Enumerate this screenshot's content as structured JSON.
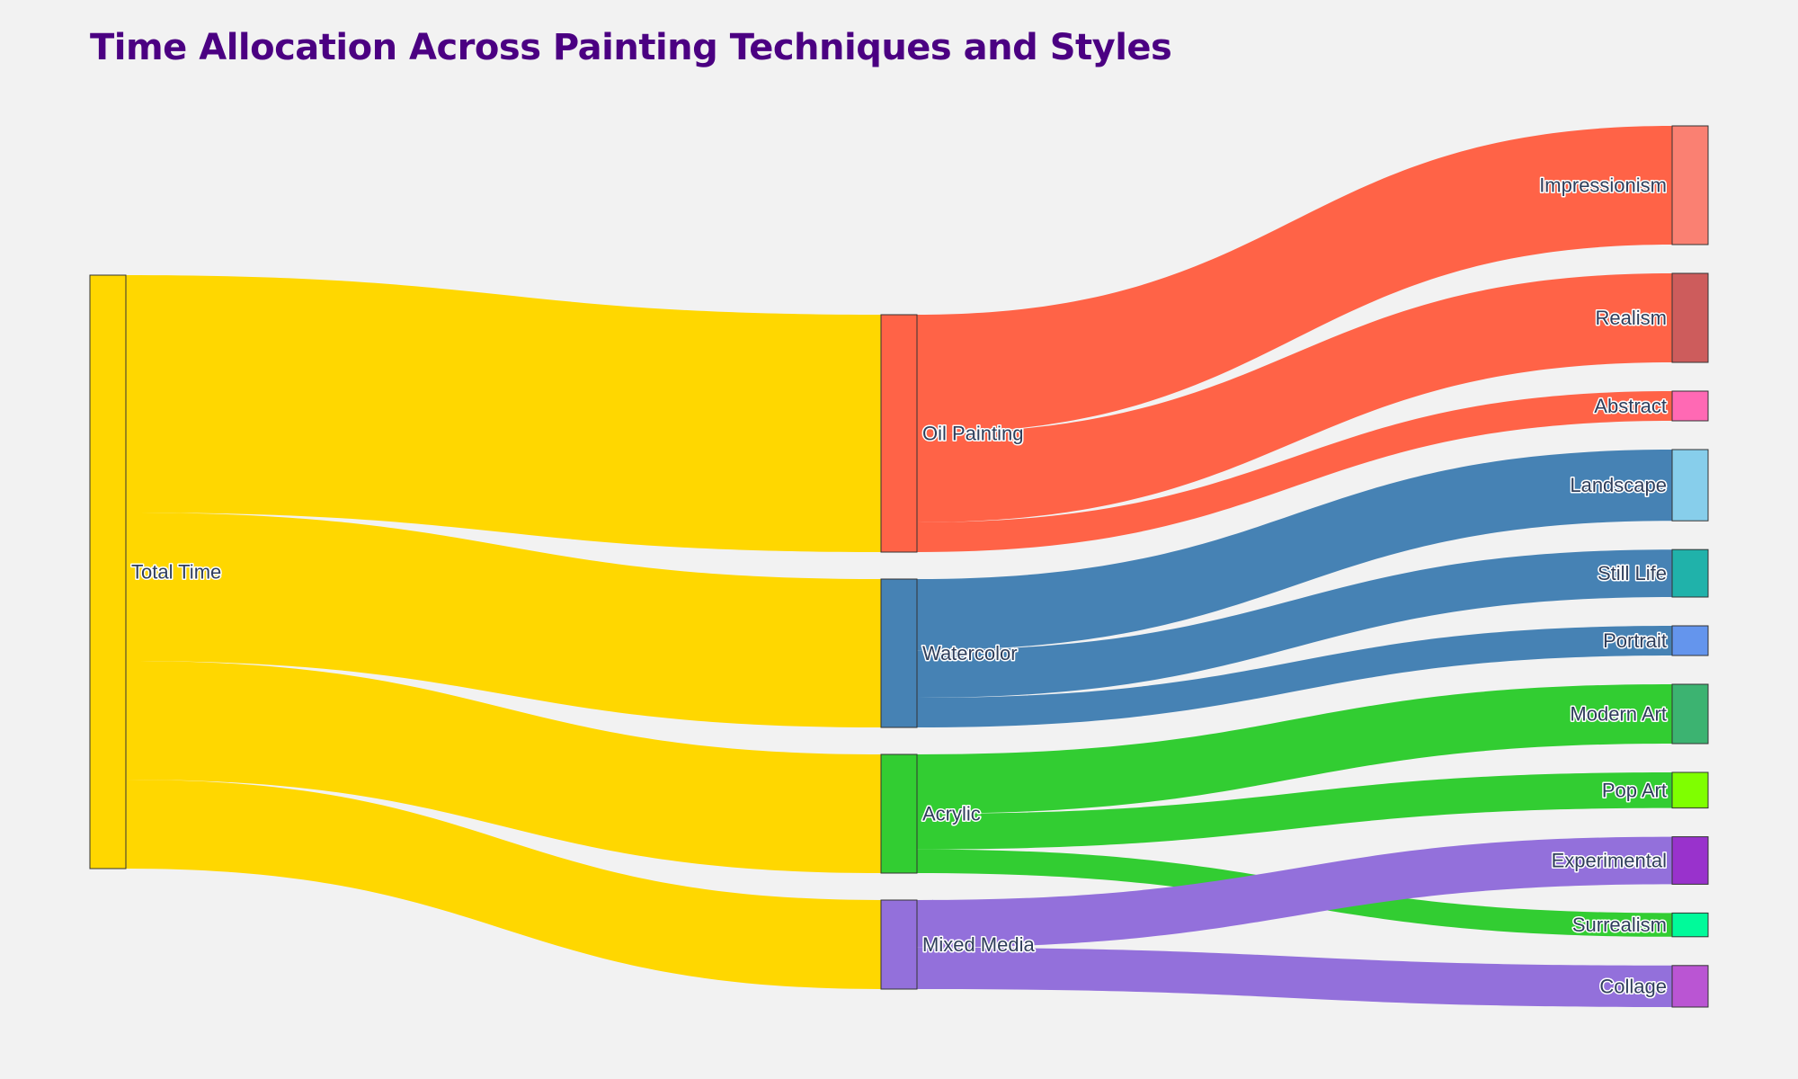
{
  "title": "Time Allocation Across Painting Techniques and Styles",
  "chart_data": {
    "type": "sankey",
    "title": "Time Allocation Across Painting Techniques and Styles",
    "nodes": [
      {
        "id": "Total Time",
        "label": "Total Time",
        "color": "#FFD700",
        "column": 0
      },
      {
        "id": "Oil Painting",
        "label": "Oil Painting",
        "color": "#FF6347",
        "column": 1
      },
      {
        "id": "Watercolor",
        "label": "Watercolor",
        "color": "#4682B4",
        "column": 1
      },
      {
        "id": "Acrylic",
        "label": "Acrylic",
        "color": "#32CD32",
        "column": 1
      },
      {
        "id": "Mixed Media",
        "label": "Mixed Media",
        "color": "#9370DB",
        "column": 1
      },
      {
        "id": "Impressionism",
        "label": "Impressionism",
        "color": "#FA8072",
        "column": 2
      },
      {
        "id": "Realism",
        "label": "Realism",
        "color": "#CD5C5C",
        "column": 2
      },
      {
        "id": "Abstract",
        "label": "Abstract",
        "color": "#FF69B4",
        "column": 2
      },
      {
        "id": "Landscape",
        "label": "Landscape",
        "color": "#87CEEB",
        "column": 2
      },
      {
        "id": "Still Life",
        "label": "Still Life",
        "color": "#20B2AA",
        "column": 2
      },
      {
        "id": "Portrait",
        "label": "Portrait",
        "color": "#6495ED",
        "column": 2
      },
      {
        "id": "Modern Art",
        "label": "Modern Art",
        "color": "#3CB371",
        "column": 2
      },
      {
        "id": "Pop Art",
        "label": "Pop Art",
        "color": "#7FFF00",
        "column": 2
      },
      {
        "id": "Experimental",
        "label": "Experimental",
        "color": "#9932CC",
        "column": 2
      },
      {
        "id": "Surrealism",
        "label": "Surrealism",
        "color": "#00FA9A",
        "column": 2
      },
      {
        "id": "Collage",
        "label": "Collage",
        "color": "#BA55D3",
        "column": 2
      }
    ],
    "links": [
      {
        "source": "Total Time",
        "target": "Oil Painting",
        "value": 40
      },
      {
        "source": "Total Time",
        "target": "Watercolor",
        "value": 25
      },
      {
        "source": "Total Time",
        "target": "Acrylic",
        "value": 20
      },
      {
        "source": "Total Time",
        "target": "Mixed Media",
        "value": 15
      },
      {
        "source": "Oil Painting",
        "target": "Impressionism",
        "value": 20
      },
      {
        "source": "Oil Painting",
        "target": "Realism",
        "value": 15
      },
      {
        "source": "Oil Painting",
        "target": "Abstract",
        "value": 5
      },
      {
        "source": "Watercolor",
        "target": "Landscape",
        "value": 12
      },
      {
        "source": "Watercolor",
        "target": "Still Life",
        "value": 8
      },
      {
        "source": "Watercolor",
        "target": "Portrait",
        "value": 5
      },
      {
        "source": "Acrylic",
        "target": "Modern Art",
        "value": 10
      },
      {
        "source": "Acrylic",
        "target": "Pop Art",
        "value": 6
      },
      {
        "source": "Acrylic",
        "target": "Surrealism",
        "value": 4
      },
      {
        "source": "Mixed Media",
        "target": "Experimental",
        "value": 8
      },
      {
        "source": "Mixed Media",
        "target": "Collage",
        "value": 7
      }
    ]
  }
}
